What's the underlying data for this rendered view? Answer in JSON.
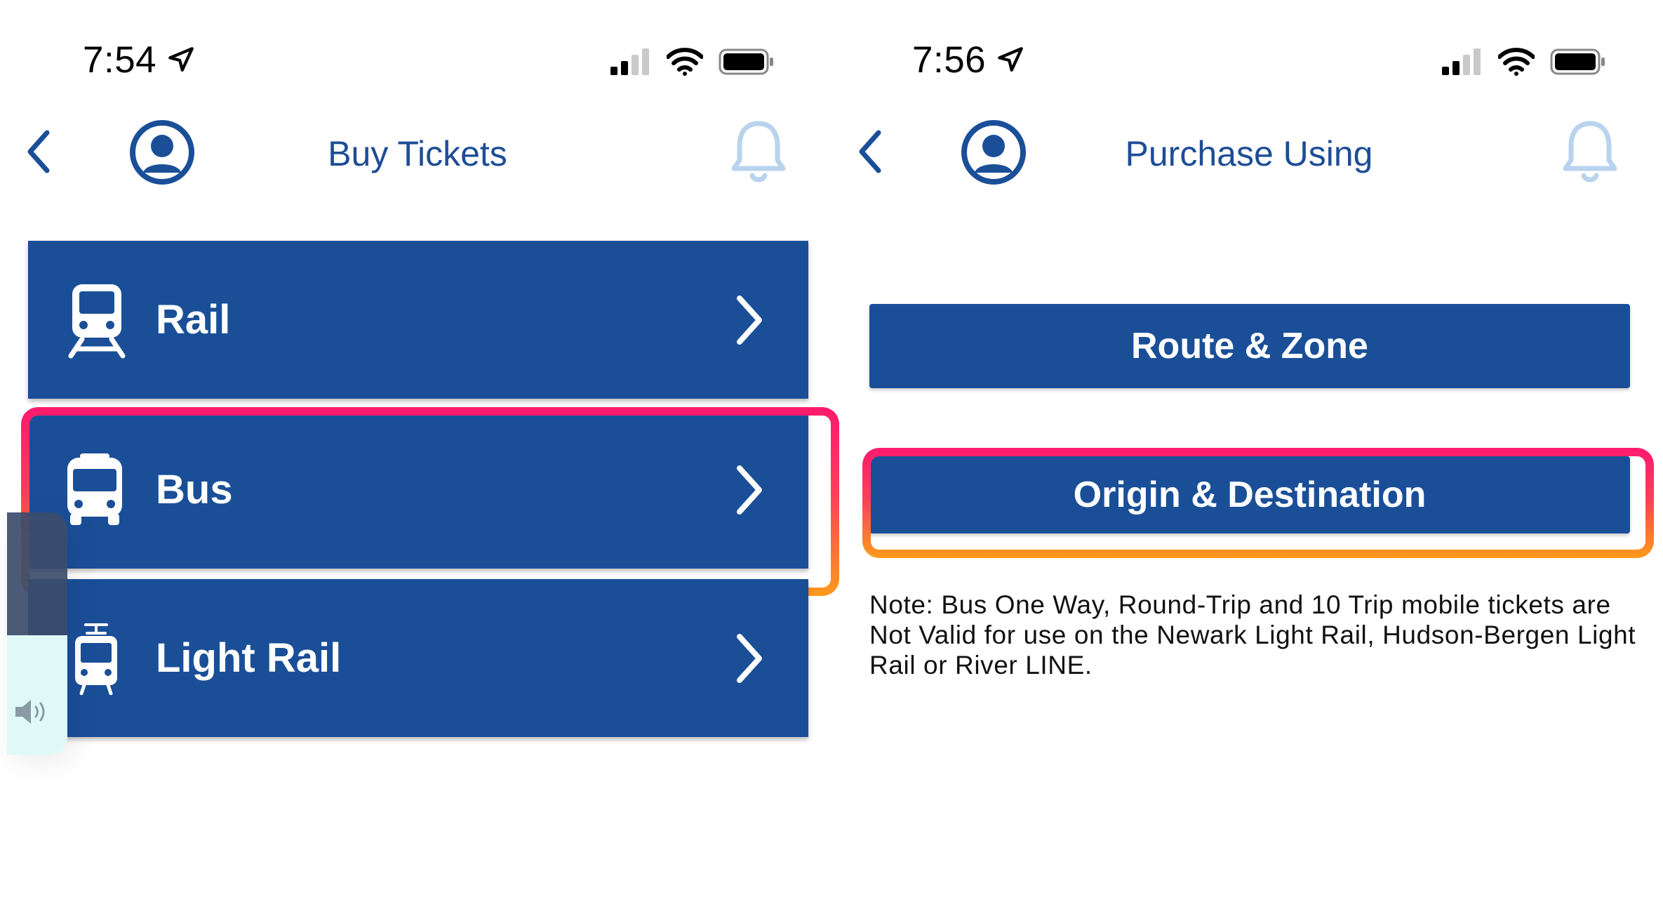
{
  "colors": {
    "brand_blue": "#1a4f98",
    "title_blue": "#1e4d96",
    "highlight_top": "#ff1a6e",
    "highlight_bottom": "#ff9a1a",
    "bell_light_blue": "#b9d3ee"
  },
  "left_screen": {
    "status_bar": {
      "time": "7:54"
    },
    "nav": {
      "title": "Buy Tickets"
    },
    "modes": [
      {
        "label": "Rail",
        "icon": "train-icon"
      },
      {
        "label": "Bus",
        "icon": "bus-icon",
        "highlighted": true
      },
      {
        "label": "Light Rail",
        "icon": "light-rail-icon"
      }
    ]
  },
  "right_screen": {
    "status_bar": {
      "time": "7:56"
    },
    "nav": {
      "title": "Purchase Using"
    },
    "buttons": [
      {
        "label": "Route & Zone"
      },
      {
        "label": "Origin & Destination",
        "highlighted": true
      }
    ],
    "note": "Note: Bus One Way, Round-Trip and 10 Trip mobile tickets are Not Valid for use on the Newark Light Rail, Hudson-Bergen Light Rail or River LINE."
  }
}
